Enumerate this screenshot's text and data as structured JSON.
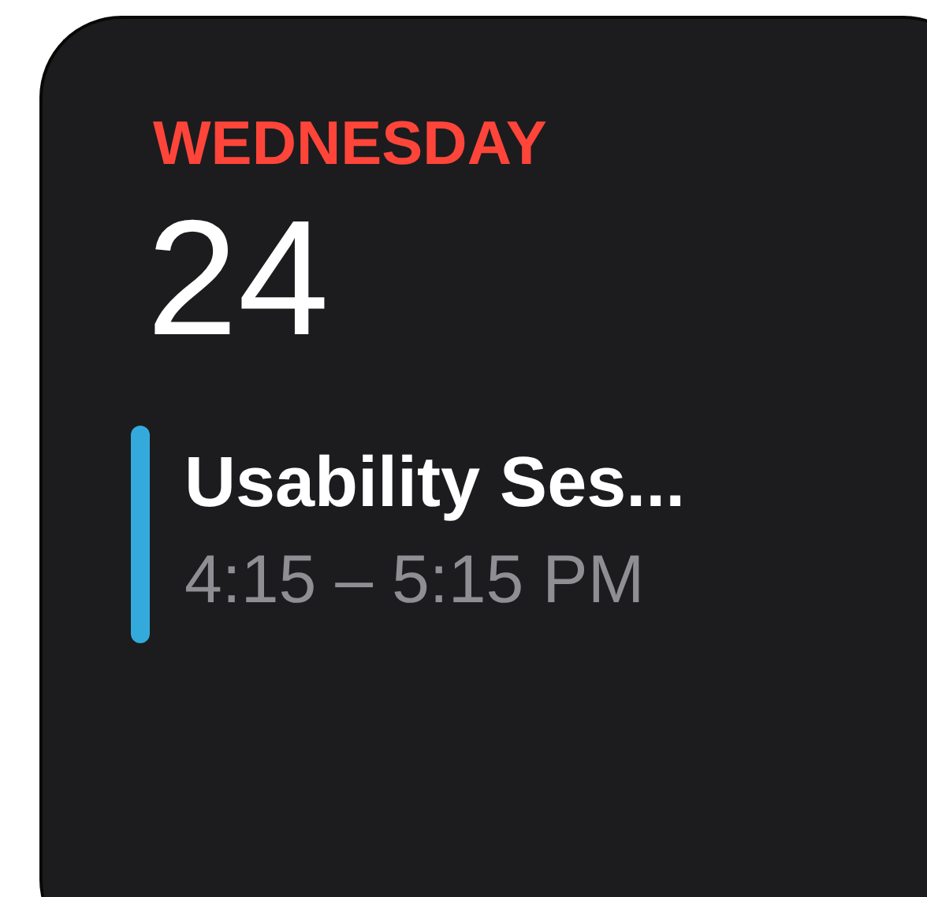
{
  "weekday": "WEDNESDAY",
  "date": "24",
  "events": [
    {
      "title": "Usability Ses...",
      "time": "4:15 – 5:15 PM",
      "color": "#34aadc"
    }
  ]
}
